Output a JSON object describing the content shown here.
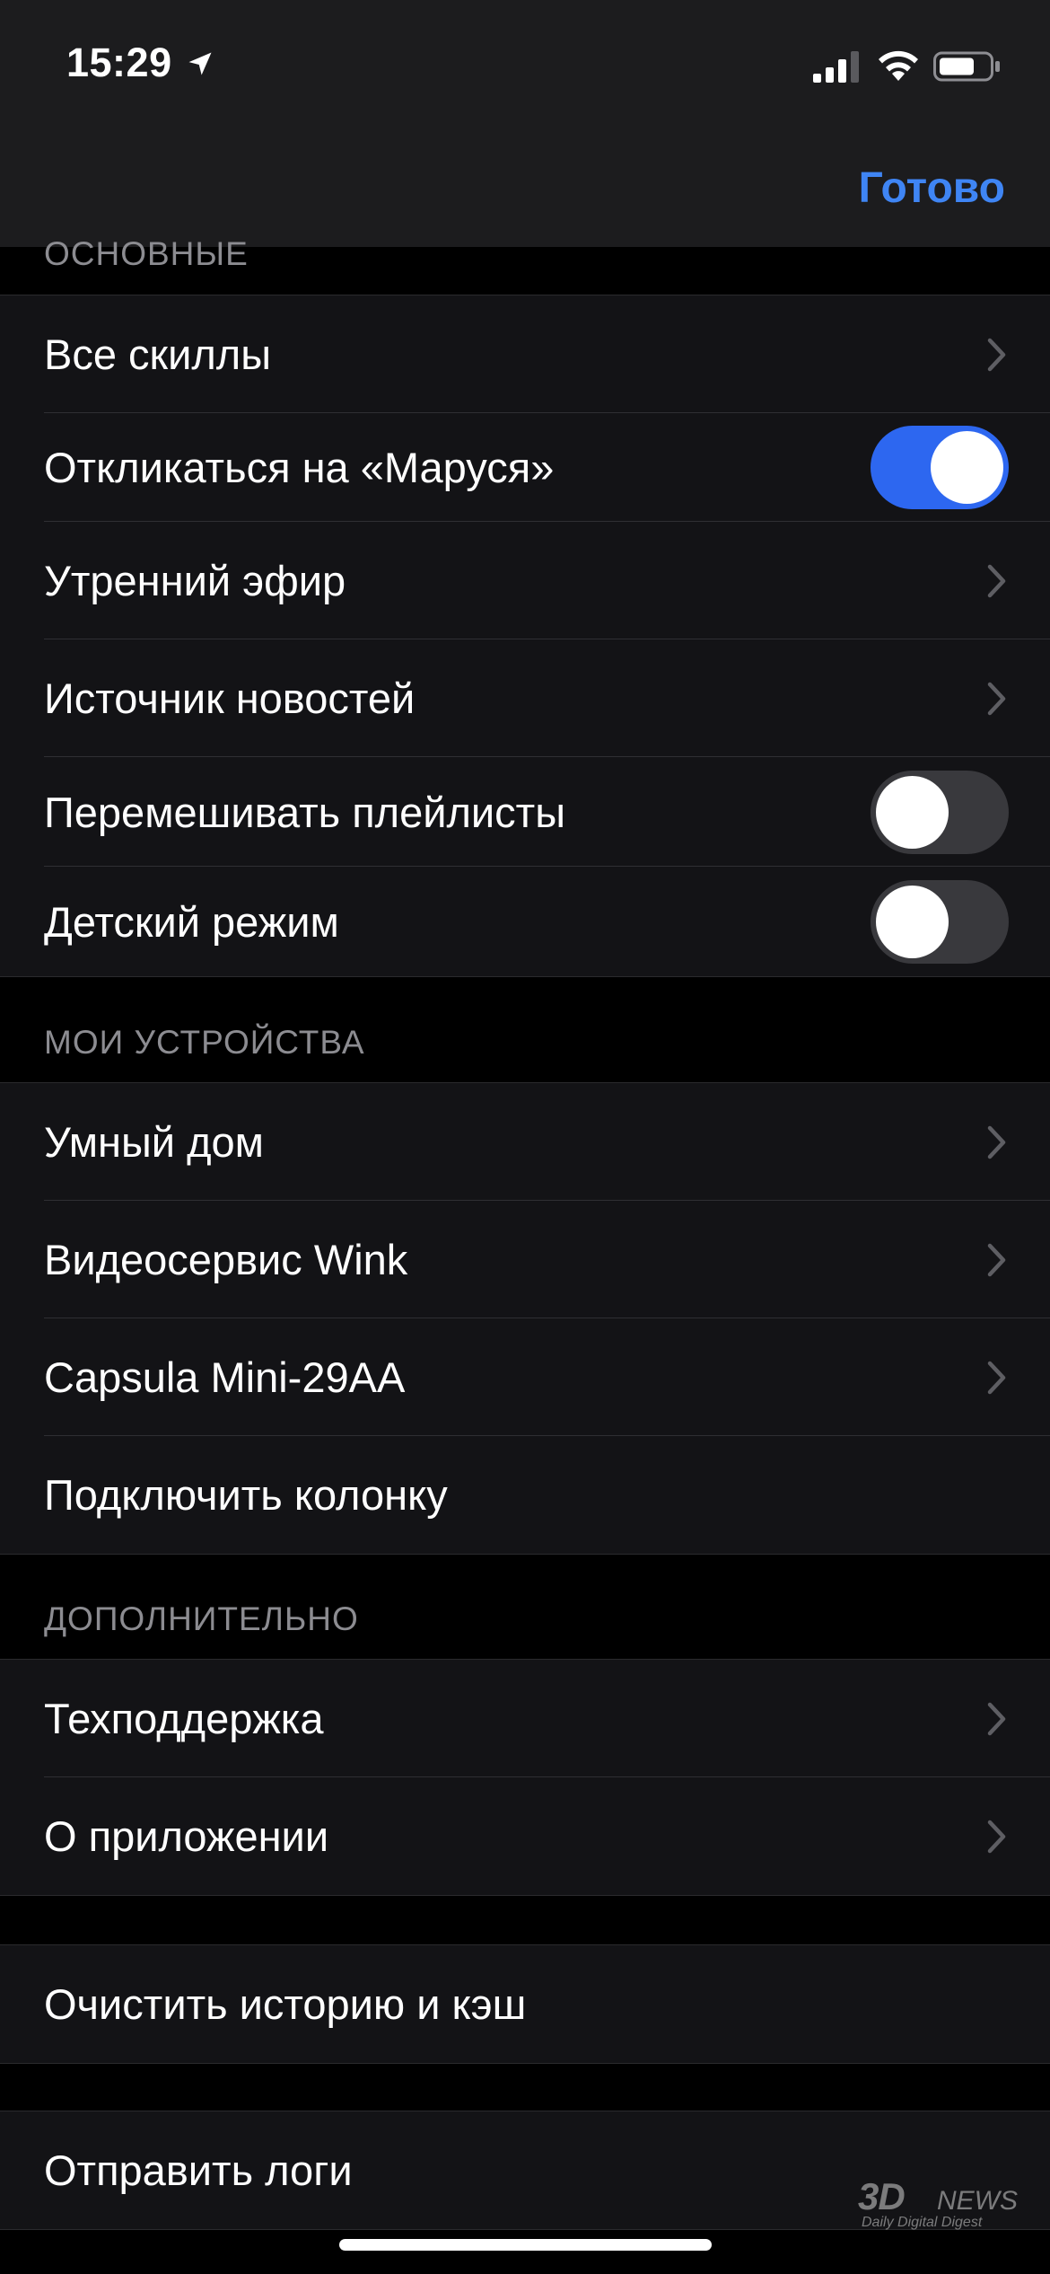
{
  "status_bar": {
    "time": "15:29",
    "icons": [
      "location-arrow-icon",
      "cellular-signal-icon",
      "wifi-icon",
      "battery-icon"
    ]
  },
  "nav": {
    "done_label": "Готово"
  },
  "sections": {
    "main": {
      "header": "ОСНОВНЫЕ",
      "rows": [
        {
          "label": "Все скиллы",
          "accessory": "chevron"
        },
        {
          "label": "Откликаться на «Маруся»",
          "accessory": "toggle",
          "on": true
        },
        {
          "label": "Утренний эфир",
          "accessory": "chevron"
        },
        {
          "label": "Источник новостей",
          "accessory": "chevron"
        },
        {
          "label": "Перемешивать плейлисты",
          "accessory": "toggle",
          "on": false
        },
        {
          "label": "Детский режим",
          "accessory": "toggle",
          "on": false
        }
      ]
    },
    "devices": {
      "header": "МОИ УСТРОЙСТВА",
      "rows": [
        {
          "label": "Умный дом",
          "accessory": "chevron"
        },
        {
          "label": "Видеосервис Wink",
          "accessory": "chevron"
        },
        {
          "label": "Capsula Mini-29AA",
          "accessory": "chevron"
        },
        {
          "label": "Подключить колонку",
          "accessory": "none"
        }
      ]
    },
    "extra": {
      "header": "ДОПОЛНИТЕЛЬНО",
      "rows": [
        {
          "label": "Техподдержка",
          "accessory": "chevron"
        },
        {
          "label": "О приложении",
          "accessory": "chevron"
        }
      ]
    },
    "clear": {
      "rows": [
        {
          "label": "Очистить историю и кэш",
          "accessory": "none"
        }
      ]
    },
    "logs": {
      "rows": [
        {
          "label": "Отправить логи",
          "accessory": "none"
        }
      ]
    }
  },
  "watermark": {
    "brand": "3D",
    "brand2": "NEWS",
    "tagline": "Daily Digital Digest"
  },
  "colors": {
    "accent": "#3f85f4",
    "toggle_on": "#2d67f0",
    "row_bg": "#131316"
  }
}
